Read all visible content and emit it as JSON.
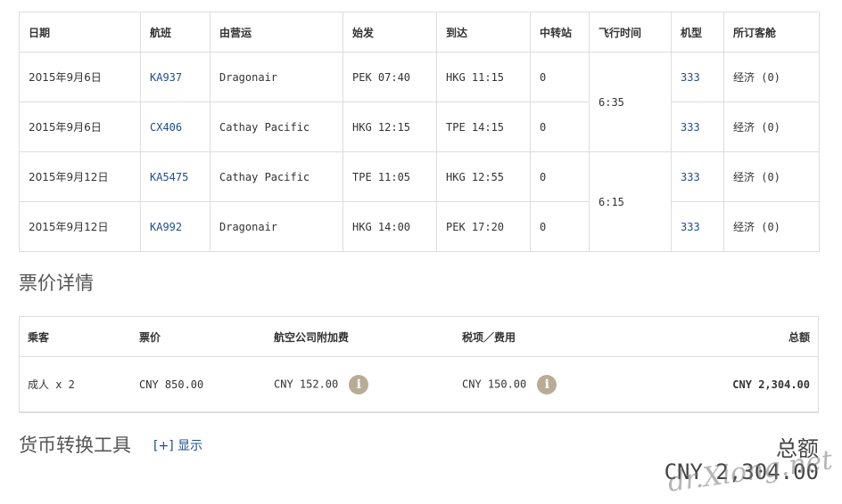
{
  "flights": {
    "headers": [
      "日期",
      "航班",
      "由营运",
      "始发",
      "到达",
      "中转站",
      "飞行时间",
      "机型",
      "所订客舱"
    ],
    "rows": [
      {
        "date": "2015年9月6日",
        "flight": "KA937",
        "operator": "Dragonair",
        "dep": "PEK 07:40",
        "arr": "HKG 11:15",
        "stops": "0",
        "aircraft": "333",
        "cabin": "经济 (0)"
      },
      {
        "date": "2015年9月6日",
        "flight": "CX406",
        "operator": "Cathay Pacific",
        "dep": "HKG 12:15",
        "arr": "TPE 14:15",
        "stops": "0",
        "aircraft": "333",
        "cabin": "经济 (0)"
      },
      {
        "date": "2015年9月12日",
        "flight": "KA5475",
        "operator": "Cathay Pacific",
        "dep": "TPE 11:05",
        "arr": "HKG 12:55",
        "stops": "0",
        "aircraft": "333",
        "cabin": "经济 (0)"
      },
      {
        "date": "2015年9月12日",
        "flight": "KA992",
        "operator": "Dragonair",
        "dep": "HKG 14:00",
        "arr": "PEK 17:20",
        "stops": "0",
        "aircraft": "333",
        "cabin": "经济 (0)"
      }
    ],
    "durations": [
      "6:35",
      "6:15"
    ]
  },
  "fare_title": "票价详情",
  "fares": {
    "headers": [
      "乘客",
      "票价",
      "航空公司附加费",
      "税项／费用",
      "总额"
    ],
    "row": {
      "passenger": "成人 x 2",
      "fare": "CNY 850.00",
      "surcharge": "CNY 152.00",
      "tax": "CNY 150.00",
      "total": "CNY 2,304.00"
    },
    "info_icon": "i"
  },
  "currency_tool": {
    "title": "货币转换工具",
    "toggle": "[+] 显示"
  },
  "grand_total": {
    "label": "总额",
    "amount": "CNY 2,304.00"
  },
  "watermark": "dr.Xiong.net"
}
